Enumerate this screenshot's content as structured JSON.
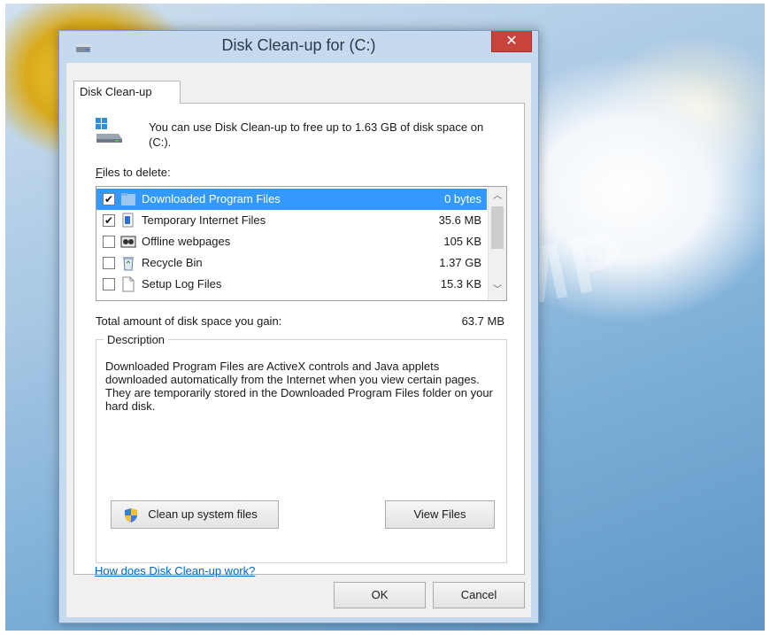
{
  "window": {
    "title": "Disk Clean-up for  (C:)",
    "close_glyph": "✕"
  },
  "tab": {
    "label": "Disk Clean-up"
  },
  "intro_text": "You can use Disk Clean-up to free up to 1.63 GB of disk space on  (C:).",
  "files_label": "Files to delete:",
  "files": [
    {
      "name": "Downloaded Program Files",
      "size": "0 bytes",
      "checked": true,
      "selected": true,
      "icon": "folder-icon"
    },
    {
      "name": "Temporary Internet Files",
      "size": "35.6 MB",
      "checked": true,
      "selected": false,
      "icon": "internet-files-icon"
    },
    {
      "name": "Offline webpages",
      "size": "105 KB",
      "checked": false,
      "selected": false,
      "icon": "offline-webpages-icon"
    },
    {
      "name": "Recycle Bin",
      "size": "1.37 GB",
      "checked": false,
      "selected": false,
      "icon": "recycle-bin-icon"
    },
    {
      "name": "Setup Log Files",
      "size": "15.3 KB",
      "checked": false,
      "selected": false,
      "icon": "document-icon"
    }
  ],
  "check_glyph": "✔",
  "scroll": {
    "up_glyph": "︿",
    "down_glyph": "﹀"
  },
  "total": {
    "label": "Total amount of disk space you gain:",
    "value": "63.7 MB"
  },
  "description": {
    "title": "Description",
    "text": "Downloaded Program Files are ActiveX controls and Java applets downloaded automatically from the Internet when you view certain pages. They are temporarily stored in the Downloaded Program Files folder on your hard disk."
  },
  "buttons": {
    "cleanup_system": "Clean up system files",
    "view_files": "View Files",
    "ok": "OK",
    "cancel": "Cancel"
  },
  "help_link": "How does Disk Clean-up work?",
  "watermark": "MP",
  "colors": {
    "selection": "#3399ff",
    "close": "#c7433b",
    "link": "#0066cc",
    "frame": "#c6daef"
  }
}
